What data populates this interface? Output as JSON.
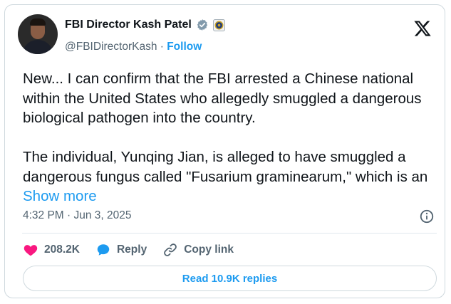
{
  "author": {
    "display_name": "FBI Director Kash Patel",
    "handle": "@FBIDirectorKash",
    "separator": " · ",
    "follow_label": "Follow",
    "verified_icon": "verified-badge-icon",
    "affiliation_icon": "fbi-seal-icon"
  },
  "tweet": {
    "text": "New... I can confirm that the FBI arrested a Chinese national within the United States who allegedly smuggled a dangerous biological pathogen into the country.\n\nThe individual, Yunqing Jian, is alleged to have smuggled a dangerous fungus called \"Fusarium graminearum,\" which is an ",
    "show_more": "Show more",
    "timestamp": "4:32 PM · Jun 3, 2025"
  },
  "actions": {
    "likes": "208.2K",
    "reply_label": "Reply",
    "copy_link_label": "Copy link"
  },
  "replies_button": "Read 10.9K replies",
  "colors": {
    "accent": "#1d9bf0",
    "like": "#f91880",
    "verified": "#829aab",
    "muted_text": "#536471"
  }
}
